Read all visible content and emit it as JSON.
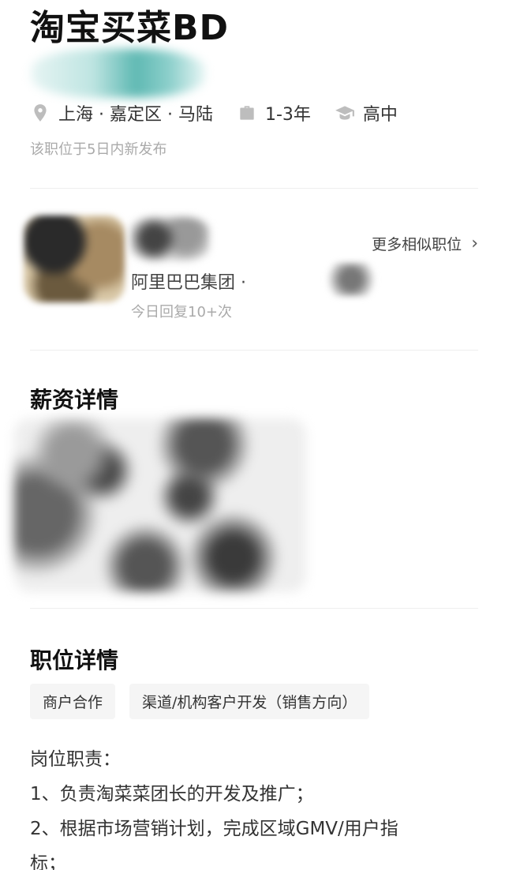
{
  "job": {
    "title": "淘宝买菜BD",
    "location": "上海 · 嘉定区 · 马陆",
    "experience": "1-3年",
    "education": "高中",
    "posted_note": "该职位于5日内新发布"
  },
  "company": {
    "name": "阿里巴巴集团 ·",
    "reply_note": "今日回复10+次",
    "more_similar": "更多相似职位",
    "more_icon": "chevron-right-icon"
  },
  "salary_section": {
    "title": "薪资详情"
  },
  "position_section": {
    "title": "职位详情",
    "tags": [
      "商户合作",
      "渠道/机构客户开发（销售方向）"
    ],
    "lines": [
      "岗位职责：",
      "1、负责淘菜菜团长的开发及推广；",
      "2、根据市场营销计划，完成区域GMV/用户指",
      "标；"
    ]
  },
  "icons": {
    "location": "location-pin-icon",
    "experience": "briefcase-icon",
    "education": "graduation-cap-icon"
  },
  "colors": {
    "text_primary": "#111111",
    "text_secondary": "#aaaaaa",
    "tag_bg": "#f5f5f5"
  }
}
